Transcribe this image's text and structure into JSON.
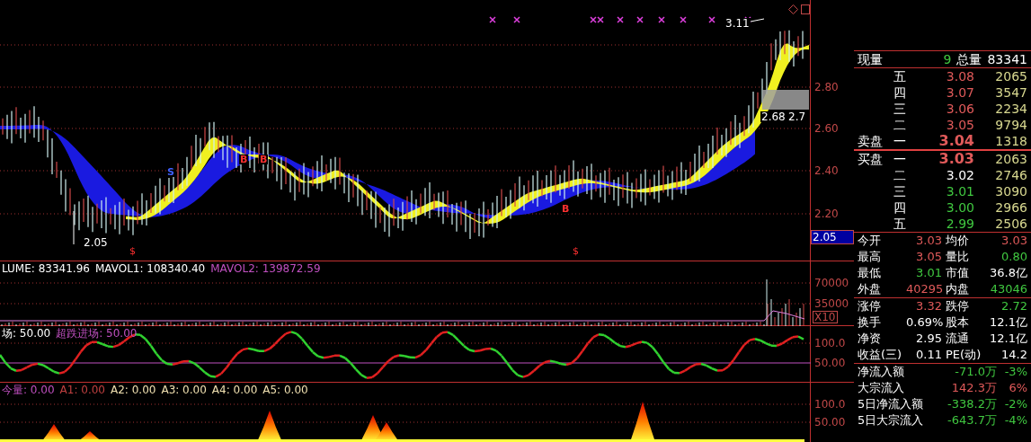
{
  "price_chart": {
    "y_axis": [
      "2.80",
      "2.60",
      "2.40",
      "2.20"
    ],
    "last_price": "2.05",
    "annotations": [
      "3.11",
      "2.68",
      "2.7",
      "2.05"
    ],
    "signals": [
      {
        "text": "S",
        "kind": "sell"
      },
      {
        "text": "B",
        "kind": "buy"
      },
      {
        "text": "B",
        "kind": "buy"
      },
      {
        "text": "B",
        "kind": "buy"
      }
    ],
    "markers": [
      "$",
      "$"
    ]
  },
  "volume_chart": {
    "legend": [
      {
        "text": "LUME: 83341.96",
        "color": "#ffffff"
      },
      {
        "text": "MAVOL1: 108340.40",
        "color": "#ffffff"
      },
      {
        "text": "MAVOL2: 139872.59",
        "color": "#c050c0"
      }
    ],
    "y_axis": [
      "70000",
      "35000"
    ],
    "multiplier": "X10"
  },
  "indicator_chart": {
    "legend": [
      {
        "text": "场: 50.00",
        "color": "#ffffff"
      },
      {
        "text": "超跌进场: 50.00",
        "color": "#c050c0"
      }
    ],
    "y_axis": [
      "100.0",
      "50.00"
    ]
  },
  "flow_chart": {
    "legend": [
      {
        "text": "今量: 0.00",
        "color": "#c050c0"
      },
      {
        "text": "A1: 0.00",
        "color": "#c04040"
      },
      {
        "text": "A2: 0.00",
        "color": "#f0e0b0"
      },
      {
        "text": "A3: 0.00",
        "color": "#f0e0b0"
      },
      {
        "text": "A4: 0.00",
        "color": "#f0e0b0"
      },
      {
        "text": "A5: 0.00",
        "color": "#f0e0b0"
      }
    ],
    "y_axis": [
      "100.0",
      "50.00"
    ]
  },
  "quote": {
    "header": {
      "label_1": "现量",
      "value_1": "9",
      "label_2": "总量",
      "value_2": "83341"
    },
    "asks": [
      {
        "level": "五",
        "price": "3.08",
        "color": "#e05a5a",
        "volume": "2065",
        "best": false
      },
      {
        "level": "四",
        "price": "3.07",
        "color": "#e05a5a",
        "volume": "3547",
        "best": false
      },
      {
        "level": "三",
        "price": "3.06",
        "color": "#e05a5a",
        "volume": "2234",
        "best": false
      },
      {
        "level": "二",
        "price": "3.05",
        "color": "#e05a5a",
        "volume": "9794",
        "best": false
      },
      {
        "side": "卖盘",
        "level": "一",
        "price": "3.04",
        "color": "#e05a5a",
        "volume": "1318",
        "best": true
      }
    ],
    "bids": [
      {
        "side": "买盘",
        "level": "一",
        "price": "3.03",
        "color": "#e05a5a",
        "volume": "2063",
        "best": true
      },
      {
        "level": "二",
        "price": "3.02",
        "color": "#ffffff",
        "volume": "2746",
        "best": false
      },
      {
        "level": "三",
        "price": "3.01",
        "color": "#40c840",
        "volume": "3090",
        "best": false
      },
      {
        "level": "四",
        "price": "3.00",
        "color": "#40c840",
        "volume": "2966",
        "best": false
      },
      {
        "level": "五",
        "price": "2.99",
        "color": "#40c840",
        "volume": "2506",
        "best": false
      }
    ],
    "stats_1": [
      {
        "label": "今开",
        "value": "3.03",
        "color": "#e05a5a"
      },
      {
        "label": "均价",
        "value": "3.03",
        "color": "#e05a5a"
      },
      {
        "label": "最高",
        "value": "3.05",
        "color": "#e05a5a"
      },
      {
        "label": "量比",
        "value": "0.80",
        "color": "#40c840"
      },
      {
        "label": "最低",
        "value": "3.01",
        "color": "#40c840"
      },
      {
        "label": "市值",
        "value": "36.8亿",
        "color": "#ffffff"
      },
      {
        "label": "外盘",
        "value": "40295",
        "color": "#e05a5a"
      },
      {
        "label": "内盘",
        "value": "43046",
        "color": "#40c840"
      }
    ],
    "stats_2": [
      {
        "label": "涨停",
        "value": "3.32",
        "color": "#e05a5a"
      },
      {
        "label": "跌停",
        "value": "2.72",
        "color": "#40c840"
      },
      {
        "label": "换手",
        "value": "0.69%",
        "color": "#ffffff"
      },
      {
        "label": "股本",
        "value": "12.1亿",
        "color": "#ffffff"
      },
      {
        "label": "净资",
        "value": "2.95",
        "color": "#ffffff"
      },
      {
        "label": "流通",
        "value": "12.1亿",
        "color": "#ffffff"
      },
      {
        "label": "收益(三)",
        "value": "0.11",
        "color": "#ffffff"
      },
      {
        "label": "PE(动)",
        "value": "14.2",
        "color": "#ffffff"
      }
    ],
    "flows": [
      {
        "label": "净流入额",
        "amount": "-71.0万",
        "percent": "-3%",
        "color": "#40c840"
      },
      {
        "label": "大宗流入",
        "amount": "142.3万",
        "percent": "6%",
        "color": "#e05a5a"
      },
      {
        "label": "5日净流入额",
        "amount": "-338.2万",
        "percent": "-2%",
        "color": "#40c840"
      },
      {
        "label": "5日大宗流入",
        "amount": "-643.7万",
        "percent": "-4%",
        "color": "#40c840"
      }
    ]
  }
}
